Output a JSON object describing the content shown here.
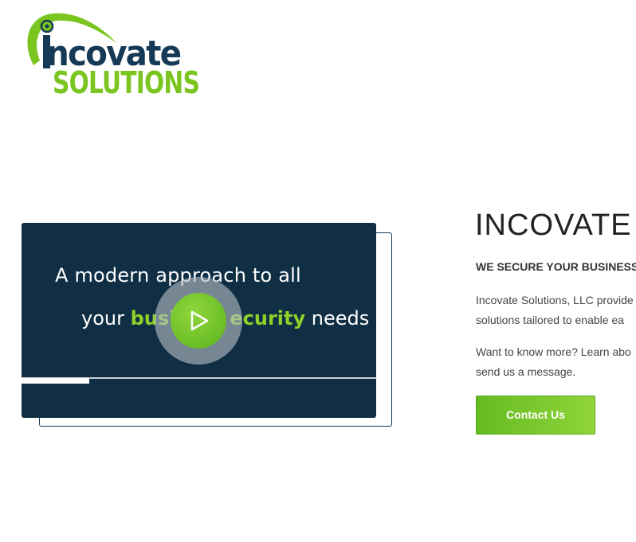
{
  "logo": {
    "word_top": "ncovate",
    "word_bottom": "SOLUTIONS",
    "brand_navy": "#163a55",
    "brand_green": "#7ac51f"
  },
  "video": {
    "line1": "A modern approach to all",
    "line2_pre": "your ",
    "line2_highlight": "busi",
    "line2_highlight2": "ecurity",
    "line2_post": " needs",
    "progress_fraction": 0.19,
    "background": "#102f44",
    "play_icon": "play-icon"
  },
  "content": {
    "title": "INCOVATE",
    "subtitle": "WE SECURE YOUR BUSINESS",
    "para1_line1": "Incovate Solutions, LLC provide",
    "para1_line2": "solutions tailored to enable ea",
    "para2_line1": "Want to know more? Learn abo",
    "para2_line2": "send us a message.",
    "contact_label": "Contact Us"
  }
}
